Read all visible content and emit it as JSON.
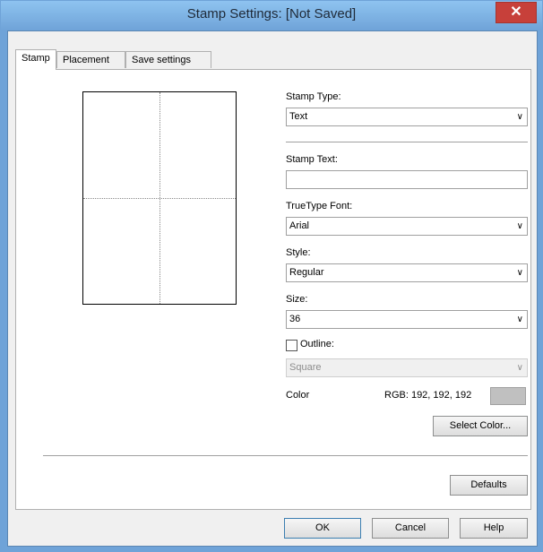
{
  "window": {
    "title": "Stamp Settings: [Not Saved]",
    "close_glyph": "✕"
  },
  "tabs": [
    {
      "label": "Stamp"
    },
    {
      "label": "Placement"
    },
    {
      "label": "Save settings"
    }
  ],
  "stamp": {
    "stamp_type": {
      "label": "Stamp Type:",
      "value": "Text"
    },
    "stamp_text": {
      "label": "Stamp Text:",
      "value": ""
    },
    "truetype_font": {
      "label": "TrueType Font:",
      "value": "Arial"
    },
    "style": {
      "label": "Style:",
      "value": "Regular"
    },
    "size": {
      "label": "Size:",
      "value": "36"
    },
    "outline": {
      "label": "Outline:",
      "checked": false,
      "value": "Square"
    },
    "color": {
      "label": "Color",
      "rgb_text": "RGB: 192, 192, 192",
      "swatch_hex": "#c0c0c0"
    },
    "select_color_label": "Select Color...",
    "defaults_label": "Defaults"
  },
  "buttons": {
    "ok": "OK",
    "cancel": "Cancel",
    "help": "Help"
  },
  "icons": {
    "dropdown": "chevron-down-icon",
    "close": "close-icon"
  }
}
